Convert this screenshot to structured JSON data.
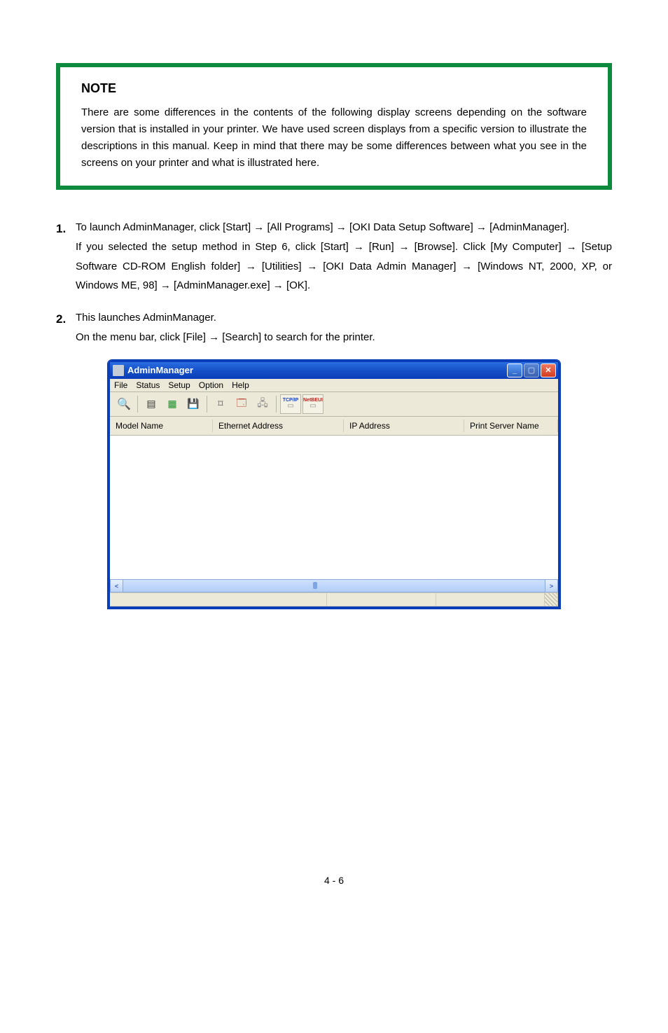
{
  "note": {
    "label": "NOTE",
    "text": "There are some differences in the contents of the following display screens depending on the software version that is installed in your printer. We have used screen displays from a specific version to illustrate the descriptions in this manual. Keep in mind that there may be some differences between what you see in the screens on your printer and what is illustrated here."
  },
  "step1": {
    "num": "1.",
    "text_a": "To launch AdminManager, click [Start] ",
    "text_b": " [All Programs] ",
    "text_c": " [OKI Data Setup Software] ",
    "text_d": " [AdminManager].",
    "text_e": "If you selected the setup method in Step 6, click [Start] ",
    "text_f": " [Run] ",
    "text_g": " [Browse]. Click [My Computer] ",
    "text_h": " [Setup Software CD-ROM English folder] ",
    "text_i": " [Utilities] ",
    "text_j": " [OKI Data Admin Manager] ",
    "text_k": " [Windows NT, 2000, XP, or Windows ME, 98] ",
    "text_l": " [AdminManager.exe] ",
    "text_m": " [OK]."
  },
  "step2": {
    "num": "2.",
    "text_a": "This launches AdminManager.",
    "text_b": "On the menu bar, click [File] ",
    "text_c": " [Search] to search for the printer."
  },
  "app": {
    "title": "AdminManager",
    "menus": [
      "File",
      "Status",
      "Setup",
      "Option",
      "Help"
    ],
    "toolbar_icons": {
      "search": "search-icon",
      "list": "list-icon",
      "grid": "grid-icon",
      "disk": "disk-icon",
      "chip": "chip-icon",
      "config": "config-icon",
      "net": "net-icon",
      "tcpip": "TCP/IP",
      "netbeui": "NetBEUI"
    },
    "columns": {
      "model": "Model Name",
      "eth": "Ethernet Address",
      "ip": "IP Address",
      "psn": "Print Server Name"
    }
  },
  "footer": "4 - 6",
  "arrow": "→"
}
